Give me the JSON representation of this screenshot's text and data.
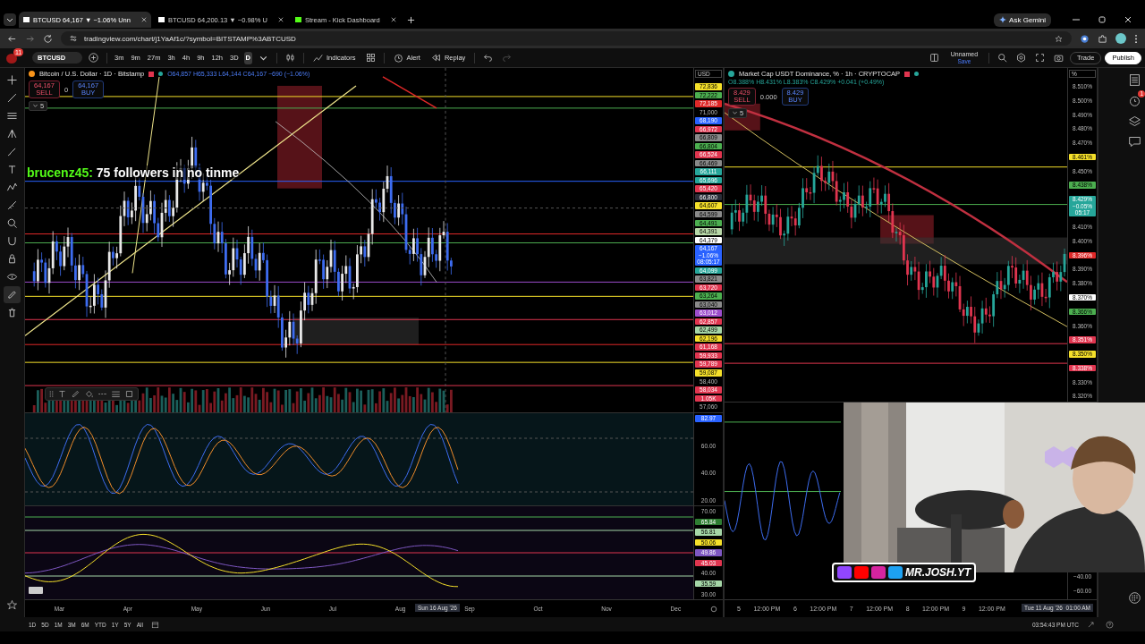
{
  "browser": {
    "tabs": [
      {
        "title": "BTCUSD 64,167 ▼ −1.06% Unn",
        "selected": true
      },
      {
        "title": "BTCUSD 64,200.13 ▼ −0.98% U",
        "selected": false
      },
      {
        "title": "Stream - Kick Dashboard",
        "selected": false
      }
    ],
    "ask_button": "Ask Gemini",
    "url": "tradingview.com/chart/j1YaAf1c/?symbol=BITSTAMP%3ABTCUSD"
  },
  "toolbar": {
    "badge": "11",
    "symbol": "BTCUSD",
    "intervals": [
      {
        "label": "3m",
        "selected": false
      },
      {
        "label": "9m",
        "selected": false
      },
      {
        "label": "27m",
        "selected": false
      },
      {
        "label": "3h",
        "selected": false
      },
      {
        "label": "4h",
        "selected": false
      },
      {
        "label": "9h",
        "selected": false
      },
      {
        "label": "12h",
        "selected": false
      },
      {
        "label": "3D",
        "selected": false
      },
      {
        "label": "D",
        "selected": true
      }
    ],
    "indicators": "Indicators",
    "alert": "Alert",
    "replay": "Replay",
    "layout_name": "Unnamed",
    "save": "Save",
    "trade": "Trade",
    "publish": "Publish"
  },
  "left_chart": {
    "title": "Bitcoin / U.S. Dollar · 1D · Bitstamp",
    "ohlc": "O64,857 H65,333 L64,144 C64,167 −690 (−1.06%)",
    "sell": {
      "price": "64,167",
      "label": "SELL"
    },
    "spread": "0",
    "buy": {
      "price": "64,167",
      "label": "BUY"
    },
    "collapse_count": "5",
    "currency": "USD",
    "overlay_user": "brucenz45:",
    "overlay_text": "75 followers in no tinme",
    "price_labels": [
      {
        "text": "72,836",
        "color": "#f5e02a"
      },
      {
        "text": "72,222",
        "color": "#4caf50"
      },
      {
        "text": "72,185",
        "color": "#e02828"
      },
      {
        "text": "71,000"
      },
      {
        "text": "68,190",
        "color": "#2962ff"
      },
      {
        "text": "66,972",
        "color": "#e0354f"
      },
      {
        "text": "66,809",
        "color": "#8a8a8a"
      },
      {
        "text": "66,804",
        "color": "#4caf50"
      },
      {
        "text": "66,524",
        "color": "#e0354f"
      },
      {
        "text": "66,469",
        "color": "#8a8a8a"
      },
      {
        "text": "66,111",
        "color": "#26a69a"
      },
      {
        "text": "65,696",
        "color": "#26a69a"
      },
      {
        "text": "65,420",
        "color": "#e0354f"
      },
      {
        "text": "66,800",
        "color": "#2a2e39"
      },
      {
        "text": "64,607",
        "color": "#f5e02a"
      },
      {
        "text": "64,599",
        "color": "#8a8a8a"
      },
      {
        "text": "64,491",
        "color": "#4caf50"
      },
      {
        "text": "64,391",
        "color": "#b8d8a8"
      },
      {
        "text": "64,379",
        "color": "#ffffff"
      },
      {
        "text": "64,167",
        "extra": [
          "−1.06%",
          "08:05:17"
        ],
        "color": "#2962ff"
      },
      {
        "text": "64,099",
        "color": "#26a69a"
      },
      {
        "text": "63,821",
        "color": "#8a8a8a"
      },
      {
        "text": "63,720",
        "color": "#e0354f"
      },
      {
        "text": "63,264",
        "color": "#4caf50"
      },
      {
        "text": "63,040",
        "color": "#8a8a8a"
      },
      {
        "text": "63,012",
        "color": "#9c4dcc"
      },
      {
        "text": "62,857",
        "color": "#e0354f"
      },
      {
        "text": "62,499",
        "color": "#a5d6a7"
      },
      {
        "text": "62,196",
        "color": "#f5e02a"
      },
      {
        "text": "61,168",
        "color": "#e0354f"
      },
      {
        "text": "59,933",
        "color": "#e0354f"
      },
      {
        "text": "59,789",
        "color": "#e0354f"
      },
      {
        "text": "59,087",
        "color": "#f5e02a"
      },
      {
        "text": "58,400"
      },
      {
        "text": "58,034",
        "color": "#e0354f"
      },
      {
        "text": "1.05K",
        "color": "#e0354f"
      },
      {
        "text": "57,060"
      }
    ],
    "osc1_labels": [
      {
        "text": "82.97",
        "color": "#2962ff"
      },
      {
        "text": "60.00"
      },
      {
        "text": "40.00"
      },
      {
        "text": "20.00"
      }
    ],
    "osc2_labels": [
      {
        "text": "70.00"
      },
      {
        "text": "65.84",
        "color": "#2e7d32"
      },
      {
        "text": "56.81",
        "color": "#a5d6a7"
      },
      {
        "text": "50.06",
        "color": "#f5e02a"
      },
      {
        "text": "49.86",
        "color": "#7e57c2"
      },
      {
        "text": "45.03",
        "color": "#e0354f"
      },
      {
        "text": "40.00"
      },
      {
        "text": "35.59",
        "color": "#a5d6a7"
      },
      {
        "text": "30.00"
      }
    ],
    "time_labels": [
      "Mar",
      "Apr",
      "May",
      "Jun",
      "Jul",
      "Aug",
      "Sep",
      "Oct",
      "Nov",
      "Dec"
    ],
    "crosshair_time": "Sun 16 Aug '26"
  },
  "right_chart": {
    "title": "Market Cap USDT Dominance, % · 1h · CRYPTOCAP",
    "ohlc": "O8.388% H8.431% L8.383% C8.429% +0.041 (+0.49%)",
    "sell": {
      "price": "8.429",
      "label": "SELL"
    },
    "spread": "0.000",
    "buy": {
      "price": "8.429",
      "label": "BUY"
    },
    "collapse_count": "5",
    "currency": "%",
    "price_labels": [
      {
        "text": "8.510%"
      },
      {
        "text": "8.500%"
      },
      {
        "text": "8.490%"
      },
      {
        "text": "8.480%"
      },
      {
        "text": "8.470%"
      },
      {
        "text": "8.461%",
        "color": "#f5e02a"
      },
      {
        "text": "8.450%"
      },
      {
        "text": "8.438%",
        "color": "#4caf50"
      },
      {
        "text": "8.429%",
        "extra": [
          "−0.05%",
          "05:17"
        ],
        "color": "#26a69a"
      },
      {
        "text": "8.410%"
      },
      {
        "text": "8.400%"
      },
      {
        "text": "8.396%",
        "color": "#e02828"
      },
      {
        "text": "8.390%"
      },
      {
        "text": "8.380%"
      },
      {
        "text": "8.370%",
        "color": "#ffffff"
      },
      {
        "text": "8.366%",
        "color": "#4caf50"
      },
      {
        "text": "8.360%"
      },
      {
        "text": "8.351%",
        "color": "#e0354f"
      },
      {
        "text": "8.350%",
        "color": "#f5e02a"
      },
      {
        "text": "8.338%",
        "color": "#e0354f"
      },
      {
        "text": "8.330%"
      },
      {
        "text": "8.320%"
      }
    ],
    "osc_labels": [
      "−40.00",
      "−60.00"
    ],
    "time_labels": [
      "5",
      "12:00 PM",
      "6",
      "12:00 PM",
      "7",
      "12:00 PM",
      "8",
      "12:00 PM",
      "9",
      "12:00 PM"
    ],
    "crosshair_time": "Tue 11 Aug '26  01:00 AM"
  },
  "webcam": {
    "kind": "picture",
    "handle": "MR.JOSH.YT"
  },
  "sidebar_badge": "1",
  "bottom": {
    "ranges": [
      "1D",
      "5D",
      "1M",
      "3M",
      "6M",
      "YTD",
      "1Y",
      "5Y",
      "All"
    ],
    "clock": "03:54:43 PM UTC"
  }
}
